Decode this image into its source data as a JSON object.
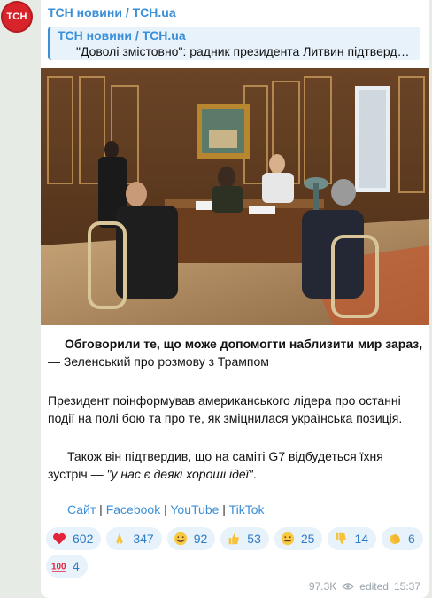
{
  "channel": {
    "avatar_text": "ТСН",
    "sender_name": "ТСН новини / TCH.ua"
  },
  "reply": {
    "sender": "ТСН новини / TCH.ua",
    "text": "\"Доволі змістовно\": радник президента Литвин підтверд…"
  },
  "message": {
    "p1_bold": "Обговорили те, що може допомогти наблизити мир зараз,",
    "p1_rest": " — Зеленський про розмову з Трампом",
    "p2": "Президент поінформував американського лідера про останні події на полі бою та про те, як зміцнилася українська позиція.",
    "p3_start": "Також він підтвердив, що на саміті G7 відбудеться їхня зустріч — ",
    "p3_quote": "\"у нас є деякі хороші ідеї\"",
    "p3_end": "."
  },
  "links": [
    {
      "label": "Сайт"
    },
    {
      "label": "Facebook"
    },
    {
      "label": "YouTube"
    },
    {
      "label": "TikTok"
    }
  ],
  "link_separator": " | ",
  "reactions": [
    {
      "emoji": "heart",
      "count": "602"
    },
    {
      "emoji": "pray",
      "count": "347"
    },
    {
      "emoji": "grin",
      "count": "92"
    },
    {
      "emoji": "thumbs-up",
      "count": "53"
    },
    {
      "emoji": "neutral-face",
      "count": "25"
    },
    {
      "emoji": "thumbs-down",
      "count": "14"
    },
    {
      "emoji": "clap",
      "count": "6"
    },
    {
      "emoji": "hundred",
      "count": "4"
    }
  ],
  "meta": {
    "views": "97.3K",
    "edited": "edited",
    "time": "15:37"
  },
  "colors": {
    "accent": "#3a8fd8",
    "avatar": "#d8232a",
    "background": "#e7ebe5"
  }
}
